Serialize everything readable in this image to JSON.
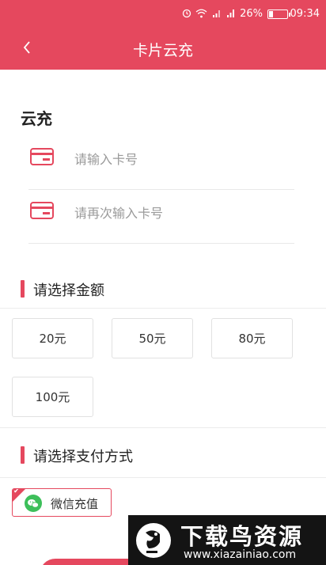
{
  "status_bar": {
    "battery_percent": "26%",
    "battery_level": 0.26,
    "time": "09:34",
    "icons": [
      "alarm-icon",
      "wifi-icon",
      "signal-icon",
      "signal-icon",
      "battery-icon"
    ]
  },
  "header": {
    "title": "卡片云充",
    "back_icon": "chevron-left-icon"
  },
  "section_title": "云充",
  "card_inputs": [
    {
      "placeholder": "请输入卡号",
      "value": "",
      "icon": "card-icon"
    },
    {
      "placeholder": "请再次输入卡号",
      "value": "",
      "icon": "card-icon"
    }
  ],
  "amount_section": {
    "title": "请选择金额",
    "options": [
      "20元",
      "50元",
      "80元",
      "100元"
    ]
  },
  "payment_section": {
    "title": "请选择支付方式",
    "options": [
      {
        "label": "微信充值",
        "selected": true,
        "icon": "wechat-icon"
      }
    ]
  },
  "watermark": {
    "title": "下载鸟资源",
    "url": "www.xiazainiao.com"
  },
  "colors": {
    "accent": "#e5485e",
    "wechat": "#3dbf5a"
  }
}
